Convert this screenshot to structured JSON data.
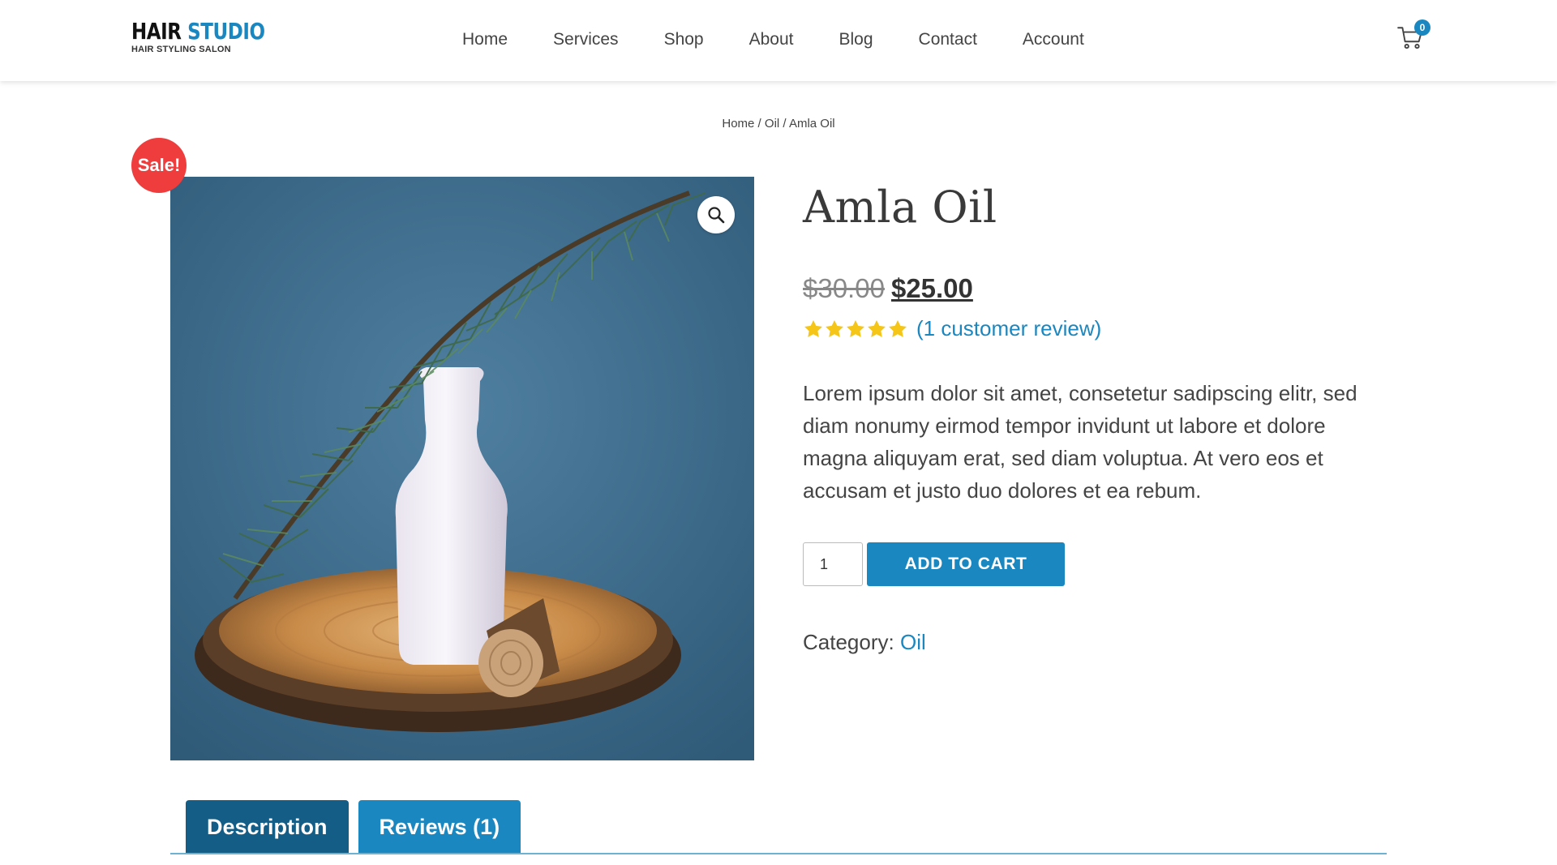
{
  "brand": {
    "name_part1": "HAIR",
    "name_part2": "STUDIO",
    "tagline": "HAIR STYLING SALON",
    "accent_color": "#1a87c0"
  },
  "nav": {
    "items": [
      {
        "label": "Home"
      },
      {
        "label": "Services"
      },
      {
        "label": "Shop"
      },
      {
        "label": "About"
      },
      {
        "label": "Blog"
      },
      {
        "label": "Contact"
      },
      {
        "label": "Account"
      }
    ]
  },
  "cart": {
    "icon": "cart-icon",
    "count": "0"
  },
  "breadcrumb": {
    "items": [
      "Home",
      "Oil",
      "Amla Oil"
    ],
    "separator": " / "
  },
  "product": {
    "sale_badge": "Sale!",
    "title": "Amla Oil",
    "old_price": "$30.00",
    "price": "$25.00",
    "rating": 5,
    "rating_max": 5,
    "review_link": "(1 customer review)",
    "description": "Lorem ipsum dolor sit amet, consetetur sadipscing elitr, sed diam nonumy eirmod tempor invidunt ut labore et dolore magna aliquyam erat, sed diam voluptua. At vero eos et accusam et justo duo dolores et ea rebum.",
    "quantity": "1",
    "add_to_cart_label": "ADD TO CART",
    "category_label": "Category:",
    "category_value": "Oil",
    "zoom_icon": "magnifier-icon"
  },
  "tabs": [
    {
      "label": "Description",
      "active": true
    },
    {
      "label": "Reviews (1)",
      "active": false
    }
  ],
  "colors": {
    "primary": "#1a87c0",
    "tab_active": "#135d86",
    "sale": "#ef3d3d",
    "star": "#f5c518"
  }
}
